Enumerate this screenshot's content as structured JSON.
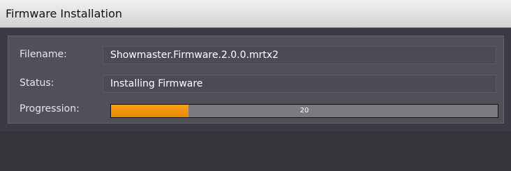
{
  "window": {
    "title": "Firmware Installation"
  },
  "fields": {
    "filename": {
      "label": "Filename:",
      "value": "Showmaster.Firmware.2.0.0.mrtx2"
    },
    "status": {
      "label": "Status:",
      "value": "Installing Firmware"
    },
    "progression": {
      "label": "Progression:",
      "percent": 20,
      "display": "20"
    }
  },
  "colors": {
    "progress_fill": "#f09513",
    "progress_track": "#7b7b7f",
    "panel_bg": "#50505a",
    "window_bg": "#3b3b43"
  }
}
